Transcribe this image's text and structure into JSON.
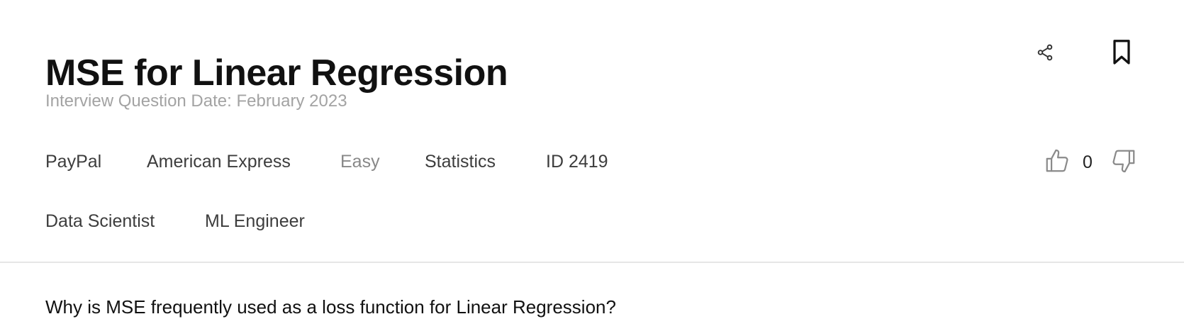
{
  "question_header": {
    "title": "MSE for Linear Regression",
    "date_line": "Interview Question Date: February 2023"
  },
  "actions": {
    "share_icon": "share-icon",
    "bookmark_icon": "bookmark-icon"
  },
  "tags": {
    "companies": [
      "PayPal",
      "American Express"
    ],
    "difficulty": "Easy",
    "category": "Statistics",
    "id_label": "ID 2419",
    "roles": [
      "Data Scientist",
      "ML Engineer"
    ]
  },
  "votes": {
    "up_icon": "thumbs-up-icon",
    "count": "0",
    "down_icon": "thumbs-down-icon"
  },
  "body": {
    "question_text": "Why is MSE frequently used as a loss function for Linear Regression?"
  },
  "colors": {
    "title": "#111111",
    "muted": "#a3a3a3",
    "tag": "#3d3d3d",
    "difficulty": "#888888",
    "divider": "#e6e6e6"
  }
}
